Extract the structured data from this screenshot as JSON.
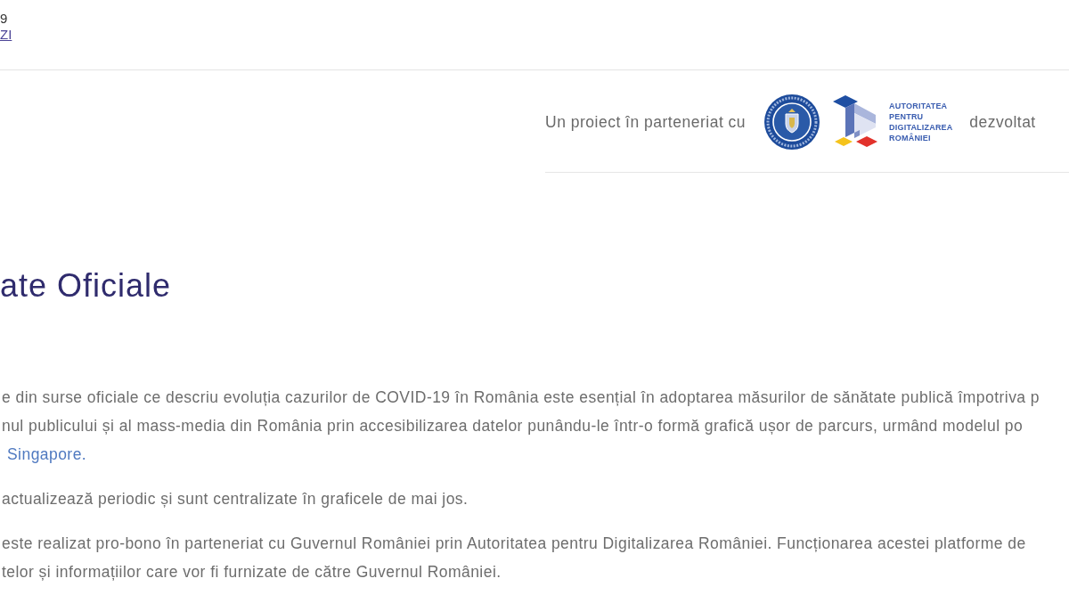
{
  "header": {
    "lines": [
      {
        "kind": "text",
        "text": "9"
      },
      {
        "kind": "link",
        "text": "ZI"
      }
    ]
  },
  "partners": {
    "intro": "Un proiect în parteneriat cu",
    "logo_wordmark": "AUTORITATEA PENTRU DIGITALIZAREA ROMÂNIEI",
    "developed_by": "dezvoltat"
  },
  "title": "ate Oficiale",
  "paragraphs": [
    {
      "lines": [
        {
          "kind": "text",
          "text": "e din surse oficiale ce descriu evoluția cazurilor de COVID-19 în România este esențial în adoptarea măsurilor de sănătate publică împotriva p"
        },
        {
          "kind": "text",
          "text": "nul publicului și al mass-media din România prin accesibilizarea datelor punându-le într-o formă grafică ușor de parcurs, urmând modelul po"
        },
        {
          "kind": "link",
          "text": "Singapore."
        }
      ]
    },
    {
      "lines": [
        {
          "kind": "text",
          "text": "actualizează periodic și sunt centralizate în graficele de mai jos."
        }
      ]
    },
    {
      "lines": [
        {
          "kind": "text",
          "text": "este realizat pro-bono în parteneriat cu Guvernul României prin Autoritatea pentru Digitalizarea României. Funcționarea acestei platforme de"
        },
        {
          "kind": "text",
          "text": "telor și informațiilor care vor fi furnizate de către Guvernul României."
        }
      ]
    }
  ]
}
